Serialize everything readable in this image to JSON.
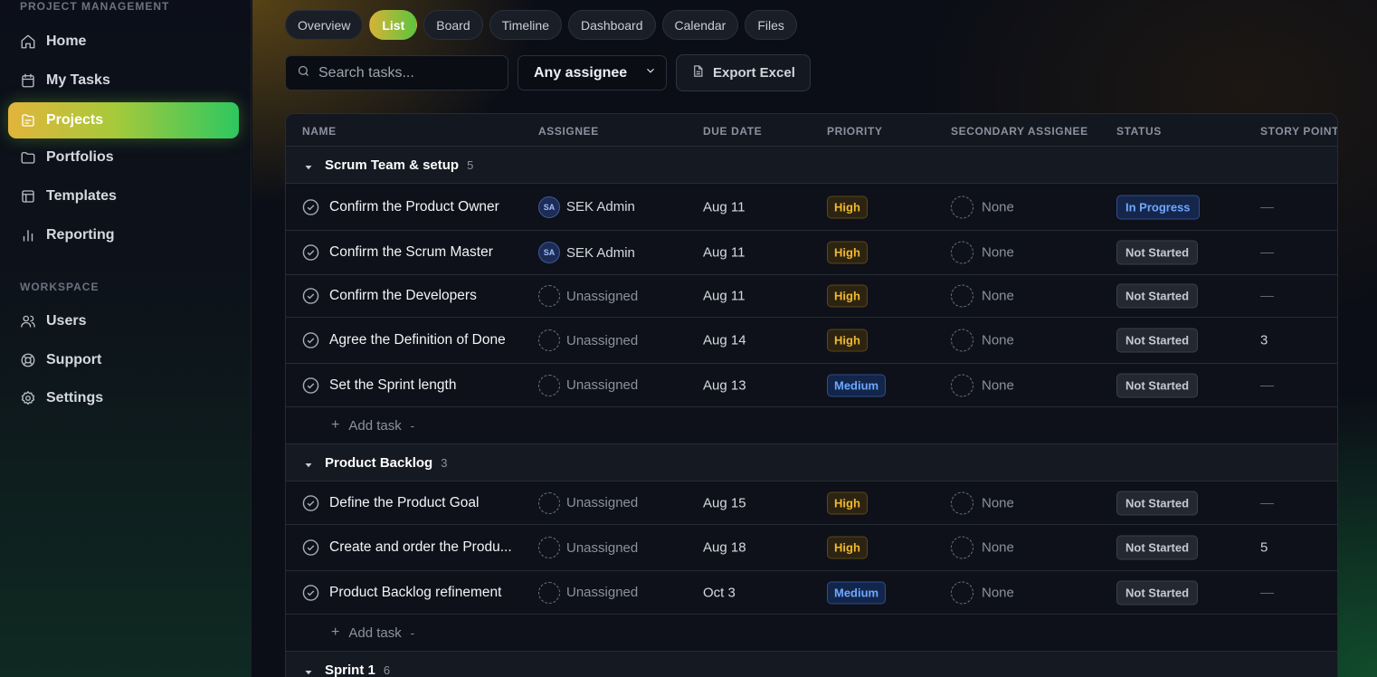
{
  "sidebar": {
    "section_project": "PROJECT MANAGEMENT",
    "section_workspace": "WORKSPACE",
    "nav": [
      {
        "label": "Home",
        "icon": "home-icon"
      },
      {
        "label": "My Tasks",
        "icon": "calendar-icon"
      },
      {
        "label": "Projects",
        "icon": "projects-icon",
        "active": true
      },
      {
        "label": "Portfolios",
        "icon": "folder-icon"
      },
      {
        "label": "Templates",
        "icon": "template-icon"
      },
      {
        "label": "Reporting",
        "icon": "bar-chart-icon"
      }
    ],
    "workspace": [
      {
        "label": "Users",
        "icon": "users-icon"
      },
      {
        "label": "Support",
        "icon": "lifebuoy-icon"
      },
      {
        "label": "Settings",
        "icon": "gear-icon"
      }
    ]
  },
  "tabs": [
    "Overview",
    "List",
    "Board",
    "Timeline",
    "Dashboard",
    "Calendar",
    "Files"
  ],
  "active_tab": "List",
  "toolbar": {
    "search_placeholder": "Search tasks...",
    "assignee_filter": "Any assignee",
    "export_label": "Export Excel"
  },
  "table": {
    "columns": [
      "NAME",
      "ASSIGNEE",
      "DUE DATE",
      "PRIORITY",
      "SECONDARY ASSIGNEE",
      "STATUS",
      "STORY POINT"
    ],
    "add_task_label": "Add task",
    "add_task_suffix": "-",
    "groups": [
      {
        "name": "Scrum Team & setup",
        "count": "5",
        "tasks": [
          {
            "name": "Confirm the Product Owner",
            "assignee_initials": "SA",
            "assignee": "SEK Admin",
            "due": "Aug 11",
            "priority": "High",
            "secondary": "None",
            "status": "In Progress",
            "points": "—"
          },
          {
            "name": "Confirm the Scrum Master",
            "assignee_initials": "SA",
            "assignee": "SEK Admin",
            "due": "Aug 11",
            "priority": "High",
            "secondary": "None",
            "status": "Not Started",
            "points": "—"
          },
          {
            "name": "Confirm the Developers",
            "assignee": "Unassigned",
            "due": "Aug 11",
            "priority": "High",
            "secondary": "None",
            "status": "Not Started",
            "points": "—"
          },
          {
            "name": "Agree the Definition of Done",
            "assignee": "Unassigned",
            "due": "Aug 14",
            "priority": "High",
            "secondary": "None",
            "status": "Not Started",
            "points": "3"
          },
          {
            "name": "Set the Sprint length",
            "assignee": "Unassigned",
            "due": "Aug 13",
            "priority": "Medium",
            "secondary": "None",
            "status": "Not Started",
            "points": "—"
          }
        ]
      },
      {
        "name": "Product Backlog",
        "count": "3",
        "tasks": [
          {
            "name": "Define the Product Goal",
            "assignee": "Unassigned",
            "due": "Aug 15",
            "priority": "High",
            "secondary": "None",
            "status": "Not Started",
            "points": "—"
          },
          {
            "name": "Create and order the Produ...",
            "assignee": "Unassigned",
            "due": "Aug 18",
            "priority": "High",
            "secondary": "None",
            "status": "Not Started",
            "points": "5"
          },
          {
            "name": "Product Backlog refinement",
            "assignee": "Unassigned",
            "due": "Oct 3",
            "priority": "Medium",
            "secondary": "None",
            "status": "Not Started",
            "points": "—"
          }
        ]
      },
      {
        "name": "Sprint 1",
        "count": "6",
        "tasks": []
      }
    ]
  }
}
